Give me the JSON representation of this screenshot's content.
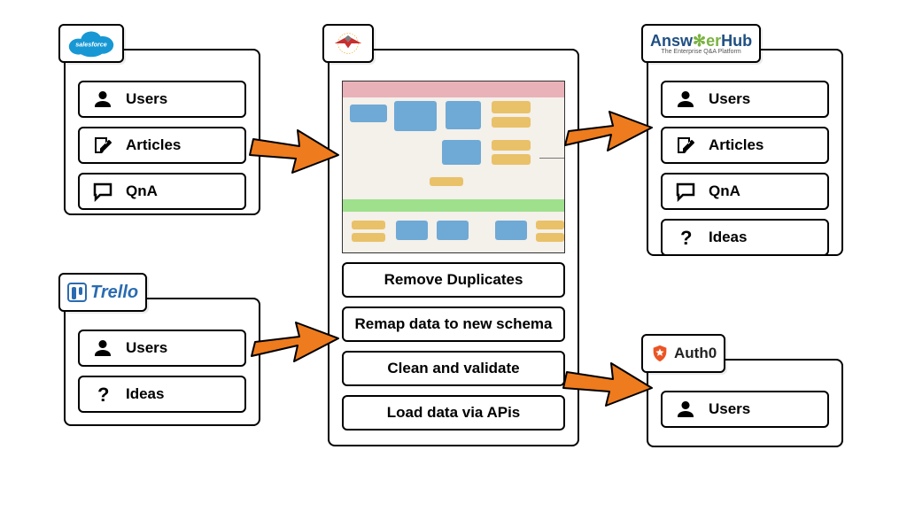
{
  "panels": {
    "salesforce": {
      "logo_name": "salesforce",
      "items": [
        {
          "icon": "user",
          "label": "Users"
        },
        {
          "icon": "edit",
          "label": "Articles"
        },
        {
          "icon": "chat",
          "label": "QnA"
        }
      ]
    },
    "trello": {
      "logo_name": "Trello",
      "items": [
        {
          "icon": "user",
          "label": "Users"
        },
        {
          "icon": "question",
          "label": "Ideas"
        }
      ]
    },
    "center": {
      "logo_name": "FME",
      "steps": [
        "Remove Duplicates",
        "Remap data to new schema",
        "Clean and validate",
        "Load data via APis"
      ]
    },
    "answerhub": {
      "logo_name": "AnswerHub",
      "logo_tagline": "The Enterprise Q&A Platform",
      "items": [
        {
          "icon": "user",
          "label": "Users"
        },
        {
          "icon": "edit",
          "label": "Articles"
        },
        {
          "icon": "chat",
          "label": "QnA"
        },
        {
          "icon": "question",
          "label": "Ideas"
        }
      ]
    },
    "auth0": {
      "logo_name": "Auth0",
      "items": [
        {
          "icon": "user",
          "label": "Users"
        }
      ]
    }
  }
}
